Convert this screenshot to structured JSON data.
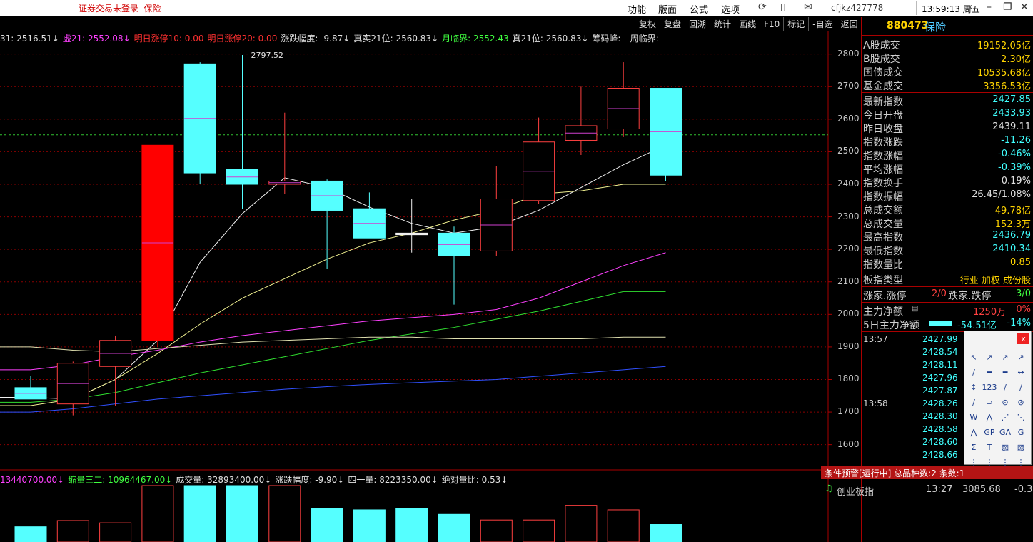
{
  "titlebar": {
    "warning": "证券交易未登录",
    "board": "保险",
    "menus": [
      "功能",
      "版面",
      "公式",
      "选项"
    ],
    "user": "cfjkz427778",
    "clock": "13:59:13 周五"
  },
  "toolbar": [
    "复权",
    "复盘",
    "回溯",
    "统计",
    "画线",
    "F10",
    "标记",
    "-自选",
    "返回"
  ],
  "infobar": {
    "items": [
      {
        "text": "31: 2516.51↓",
        "color": "#e0e0e0"
      },
      {
        "text": "虚21: 2552.08↓",
        "color": "#ff40ff"
      },
      {
        "text": "明日涨停10: 0.00",
        "color": "#ff3030"
      },
      {
        "text": "明日涨停20: 0.00",
        "color": "#ff3030"
      },
      {
        "text": "涨跌幅度: -9.87↓",
        "color": "#e0e0e0"
      },
      {
        "text": "真实21位: 2560.83↓",
        "color": "#e0e0e0"
      },
      {
        "text": "月临界: 2552.43",
        "color": "#40ff40"
      },
      {
        "text": "真21位: 2560.83↓",
        "color": "#e0e0e0"
      },
      {
        "text": "筹码峰: -",
        "color": "#e0e0e0"
      },
      {
        "text": "周临界: -",
        "color": "#e0e0e0"
      }
    ]
  },
  "chart_data": {
    "type": "candlestick",
    "ylim": [
      1540,
      2830
    ],
    "yticks": [
      1600,
      1700,
      1800,
      1900,
      2000,
      2100,
      2200,
      2300,
      2400,
      2500,
      2600,
      2700,
      2800
    ],
    "peak_label": "2797.52",
    "reference_level": 2552,
    "candles": [
      {
        "o": 1775,
        "h": 1810,
        "l": 1745,
        "c": 1740,
        "color": "cyan"
      },
      {
        "o": 1725,
        "h": 1855,
        "l": 1690,
        "c": 1850,
        "color": "red"
      },
      {
        "o": 1840,
        "h": 1935,
        "l": 1720,
        "c": 1920,
        "color": "red"
      },
      {
        "o": 1920,
        "h": 2520,
        "l": 1900,
        "c": 2520,
        "color": "redfill"
      },
      {
        "o": 2770,
        "h": 2775,
        "l": 2400,
        "c": 2435,
        "color": "cyan"
      },
      {
        "o": 2445,
        "h": 2797,
        "l": 2325,
        "c": 2400,
        "color": "cyan"
      },
      {
        "o": 2400,
        "h": 2620,
        "l": 2370,
        "c": 2410,
        "color": "red"
      },
      {
        "o": 2410,
        "h": 2415,
        "l": 2140,
        "c": 2320,
        "color": "cyan"
      },
      {
        "o": 2325,
        "h": 2375,
        "l": 2235,
        "c": 2235,
        "color": "cyan"
      },
      {
        "o": 2250,
        "h": 2355,
        "l": 2190,
        "c": 2245,
        "color": "flat"
      },
      {
        "o": 2250,
        "h": 2270,
        "l": 2030,
        "c": 2180,
        "color": "cyan"
      },
      {
        "o": 2195,
        "h": 2455,
        "l": 2180,
        "c": 2355,
        "color": "red"
      },
      {
        "o": 2350,
        "h": 2605,
        "l": 2340,
        "c": 2530,
        "color": "red"
      },
      {
        "o": 2535,
        "h": 2700,
        "l": 2490,
        "c": 2580,
        "color": "red"
      },
      {
        "o": 2570,
        "h": 2775,
        "l": 2545,
        "c": 2695,
        "color": "red"
      },
      {
        "o": 2695,
        "h": 2695,
        "l": 2410,
        "c": 2428,
        "color": "cyan"
      }
    ],
    "ma_lines": [
      {
        "name": "MA-white",
        "color": "#f0f0f0",
        "values": [
          1745,
          1740,
          1800,
          1920,
          2160,
          2310,
          2420,
          2390,
          2330,
          2280,
          2250,
          2270,
          2320,
          2390,
          2460,
          2520
        ]
      },
      {
        "name": "MA-yellow",
        "color": "#f0f090",
        "values": [
          1720,
          1740,
          1800,
          1880,
          1970,
          2050,
          2110,
          2170,
          2220,
          2250,
          2290,
          2320,
          2370,
          2380,
          2400,
          2400
        ]
      },
      {
        "name": "MA-magenta",
        "color": "#ff40ff",
        "values": [
          1830,
          1845,
          1870,
          1890,
          1915,
          1935,
          1950,
          1965,
          1980,
          1990,
          2000,
          2015,
          2050,
          2100,
          2150,
          2190
        ]
      },
      {
        "name": "MA-green",
        "color": "#30e030",
        "values": [
          1730,
          1740,
          1760,
          1790,
          1820,
          1845,
          1870,
          1895,
          1920,
          1940,
          1960,
          1985,
          2010,
          2040,
          2070,
          2070
        ]
      },
      {
        "name": "MA-lightyellow",
        "color": "#e0e0b0",
        "values": [
          1900,
          1890,
          1885,
          1895,
          1905,
          1915,
          1920,
          1925,
          1930,
          1930,
          1925,
          1925,
          1925,
          1925,
          1930,
          1930
        ]
      },
      {
        "name": "MA-blue",
        "color": "#3050ff",
        "values": [
          1700,
          1710,
          1725,
          1740,
          1750,
          1760,
          1770,
          1778,
          1785,
          1790,
          1795,
          1800,
          1810,
          1820,
          1830,
          1840
        ]
      }
    ],
    "volume": [
      {
        "v": 0.27,
        "color": "cyan"
      },
      {
        "v": 0.38,
        "color": "red"
      },
      {
        "v": 0.34,
        "color": "red"
      },
      {
        "v": 1.0,
        "color": "red"
      },
      {
        "v": 1.0,
        "color": "cyan"
      },
      {
        "v": 1.0,
        "color": "cyan"
      },
      {
        "v": 1.0,
        "color": "red"
      },
      {
        "v": 0.59,
        "color": "cyan"
      },
      {
        "v": 0.57,
        "color": "cyan"
      },
      {
        "v": 0.59,
        "color": "cyan"
      },
      {
        "v": 0.49,
        "color": "cyan"
      },
      {
        "v": 0.39,
        "color": "red"
      },
      {
        "v": 0.39,
        "color": "red"
      },
      {
        "v": 0.65,
        "color": "red"
      },
      {
        "v": 0.57,
        "color": "red"
      },
      {
        "v": 0.31,
        "color": "cyan"
      }
    ]
  },
  "volinfo": [
    {
      "text": "13440700.00↓",
      "color": "#ff40ff"
    },
    {
      "text": "缩量三二: 10964467.00↓",
      "color": "#40ff40"
    },
    {
      "text": "成交量: 32893400.00↓",
      "color": "#e0e0e0"
    },
    {
      "text": "涨跌幅度: -9.90↓",
      "color": "#e0e0e0"
    },
    {
      "text": "四一量: 8223350.00↓",
      "color": "#e0e0e0"
    },
    {
      "text": "绝对量比: 0.53↓",
      "color": "#e0e0e0"
    }
  ],
  "right_panel": {
    "code": "880473",
    "name": "保险",
    "market_rows": [
      {
        "label": "A股成交",
        "value": "19152.05亿",
        "color": "#ffd400"
      },
      {
        "label": "B股成交",
        "value": "2.30亿",
        "color": "#ffd400"
      },
      {
        "label": "国债成交",
        "value": "10535.68亿",
        "color": "#ffd400"
      },
      {
        "label": "基金成交",
        "value": "3356.53亿",
        "color": "#ffd400"
      }
    ],
    "index_rows": [
      {
        "label": "最新指数",
        "value": "2427.85",
        "color": "#40ffff"
      },
      {
        "label": "今日开盘",
        "value": "2433.93",
        "color": "#40ffff"
      },
      {
        "label": "昨日收盘",
        "value": "2439.11",
        "color": "#e0e0e0"
      },
      {
        "label": "指数涨跌",
        "value": "-11.26",
        "color": "#40ffff"
      },
      {
        "label": "指数涨幅",
        "value": "-0.46%",
        "color": "#40ffff"
      },
      {
        "label": "平均涨幅",
        "value": "-0.39%",
        "color": "#40ffff"
      },
      {
        "label": "指数换手",
        "value": "0.19%",
        "color": "#e0e0e0"
      },
      {
        "label": "指数振幅",
        "value": "26.45/1.08%",
        "color": "#e0e0e0"
      },
      {
        "label": "总成交额",
        "value": "49.78亿",
        "color": "#ffd400"
      },
      {
        "label": "总成交量",
        "value": "152.3万",
        "color": "#ffd400"
      },
      {
        "label": "最高指数",
        "value": "2436.79",
        "color": "#40ffff"
      },
      {
        "label": "最低指数",
        "value": "2410.34",
        "color": "#40ffff"
      },
      {
        "label": "指数量比",
        "value": "0.85",
        "color": "#ffd400"
      }
    ],
    "sector_type": {
      "label": "板指类型",
      "value": "行业 加权 成份股",
      "color": "#ffd400"
    },
    "breadth": {
      "up_label": "涨家.涨停",
      "up_value": "2/0",
      "down_label": "跌家.跌停",
      "down_value": "3/0"
    },
    "main_flow": {
      "label": "主力净额",
      "value": "1250万",
      "pct": "0%"
    },
    "flow5": {
      "label": "5日主力净额",
      "value": "-54.51亿",
      "pct": "-14%"
    },
    "ticks": [
      {
        "time": "13:57",
        "price": "2427.99"
      },
      {
        "time": "",
        "price": "2428.54"
      },
      {
        "time": "",
        "price": "2428.11"
      },
      {
        "time": "",
        "price": "2427.96"
      },
      {
        "time": "",
        "price": "2427.87"
      },
      {
        "time": "13:58",
        "price": "2428.26"
      },
      {
        "time": "",
        "price": "2428.30"
      },
      {
        "time": "",
        "price": "2428.58"
      },
      {
        "time": "",
        "price": "2428.60"
      },
      {
        "time": "",
        "price": "2428.66"
      }
    ]
  },
  "draw_tools": {
    "close": "x",
    "tools": [
      "↖",
      "↗",
      "↗",
      "↗",
      "/",
      "━",
      "━",
      "↔",
      "↕",
      "123",
      "∕",
      "∕",
      "∕",
      "⊃",
      "⊙",
      "⊘",
      "W",
      "⋀",
      "⋰",
      "⋱",
      "⋀",
      "GP",
      "GA",
      "G",
      "Σ",
      "T",
      "▧",
      "▨",
      "⋮",
      "⋮",
      "⋮",
      "⋮"
    ]
  },
  "alert": {
    "bar": "条件预警[运行中] 总品种数:2 条数:1",
    "name": "创业板指",
    "time": "13:27",
    "price": "3085.68",
    "change": "-0.3"
  }
}
